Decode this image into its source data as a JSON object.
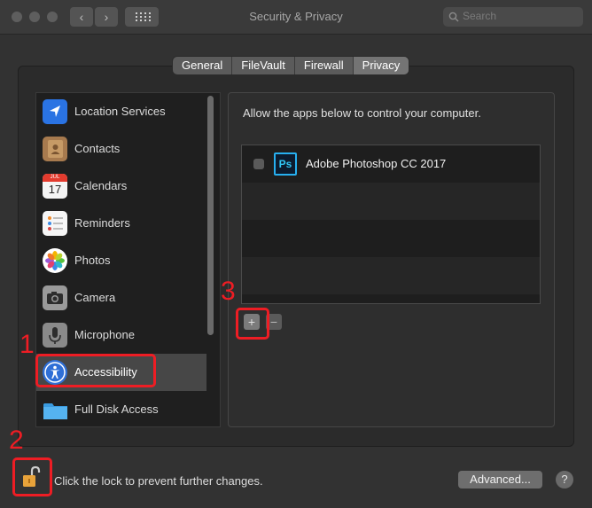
{
  "window": {
    "title": "Security & Privacy"
  },
  "toolbar": {
    "back_icon": "chevron-left-icon",
    "forward_icon": "chevron-right-icon",
    "grid_icon": "show-all-grid-icon"
  },
  "search": {
    "placeholder": "Search"
  },
  "tabs": [
    {
      "label": "General",
      "active": false
    },
    {
      "label": "FileVault",
      "active": false
    },
    {
      "label": "Firewall",
      "active": false
    },
    {
      "label": "Privacy",
      "active": true
    }
  ],
  "sidebar": {
    "items": [
      {
        "label": "Location Services",
        "icon": "location-arrow-icon"
      },
      {
        "label": "Contacts",
        "icon": "contacts-book-icon"
      },
      {
        "label": "Calendars",
        "icon": "calendar-icon",
        "icon_text_month": "JUL",
        "icon_text_day": "17"
      },
      {
        "label": "Reminders",
        "icon": "reminders-list-icon"
      },
      {
        "label": "Photos",
        "icon": "photos-flower-icon"
      },
      {
        "label": "Camera",
        "icon": "camera-icon"
      },
      {
        "label": "Microphone",
        "icon": "microphone-icon"
      },
      {
        "label": "Accessibility",
        "icon": "accessibility-icon",
        "selected": true
      },
      {
        "label": "Full Disk Access",
        "icon": "folder-icon"
      }
    ]
  },
  "main": {
    "description": "Allow the apps below to control your computer.",
    "apps": [
      {
        "name": "Adobe Photoshop CC 2017",
        "icon_text": "Ps",
        "checked": false
      }
    ],
    "add_label": "+",
    "remove_label": "−"
  },
  "footer": {
    "lock_text": "Click the lock to prevent further changes.",
    "advanced_label": "Advanced...",
    "help_label": "?"
  },
  "annotations": {
    "one": "1",
    "two": "2",
    "three": "3"
  },
  "colors": {
    "annotation_red": "#ee1d24",
    "accent_blue": "#2f6fd6",
    "ps_blue": "#31c5f4"
  }
}
